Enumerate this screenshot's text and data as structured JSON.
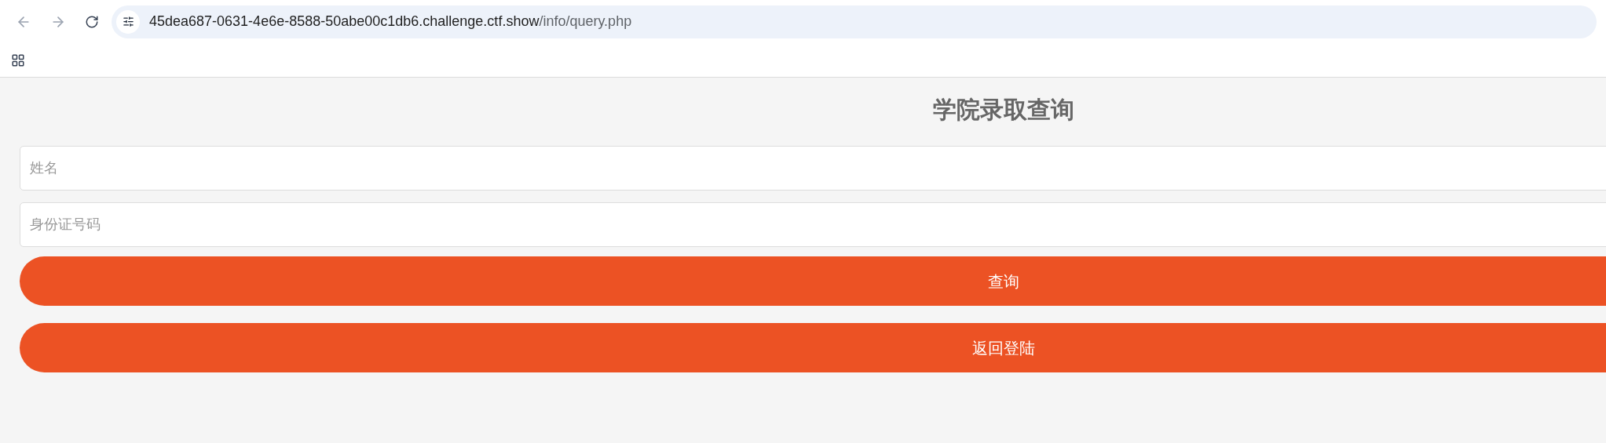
{
  "browser": {
    "url_host": "45dea687-0631-4e6e-8588-50abe00c1db6.challenge.ctf.show",
    "url_path": "/info/query.php"
  },
  "page": {
    "title": "学院录取查询",
    "fields": [
      {
        "placeholder": "姓名"
      },
      {
        "placeholder": "身份证号码"
      }
    ],
    "buttons": [
      "查询",
      "返回登陆"
    ]
  }
}
